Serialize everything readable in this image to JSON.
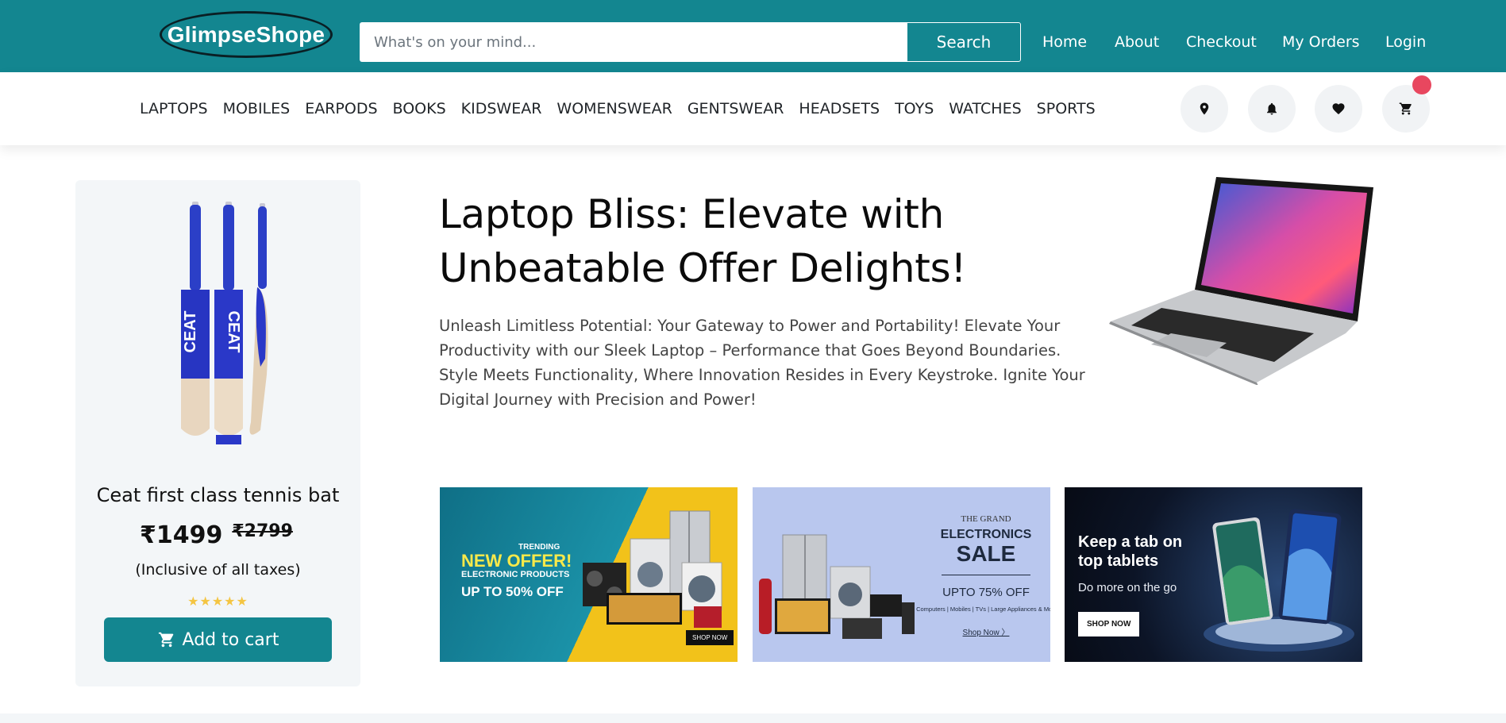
{
  "header": {
    "logo_text": "GlimpseShope",
    "search_placeholder": "What's on your mind...",
    "search_button": "Search",
    "nav": [
      "Home",
      "About",
      "Checkout",
      "My Orders",
      "Login"
    ]
  },
  "categories": [
    "LAPTOPS",
    "MOBILES",
    "EARPODS",
    "BOOKS",
    "KIDSWEAR",
    "WOMENSWEAR",
    "GENTSWEAR",
    "HEADSETS",
    "TOYS",
    "WATCHES",
    "SPORTS"
  ],
  "header_icons": [
    "location-pin-icon",
    "bell-icon",
    "heart-icon",
    "cart-icon"
  ],
  "product": {
    "name": "Ceat first class tennis bat",
    "price": "₹1499",
    "old_price": "₹2799",
    "tax_note": "(Inclusive of all taxes)",
    "rating": "★★★★★",
    "add_to_cart": "Add to cart"
  },
  "hero": {
    "title": "Laptop Bliss: Elevate with Unbeatable Offer Delights!",
    "text": "Unleash Limitless Potential: Your Gateway to Power and Portability! Elevate Your Productivity with our Sleek Laptop – Performance that Goes Beyond Boundaries. Style Meets Functionality, Where Innovation Resides in Every Keystroke. Ignite Your Digital Journey with Precision and Power!"
  },
  "banners": {
    "b1": {
      "trending": "TRENDING",
      "offer": "NEW OFFER!",
      "sub": "ELECTRONIC PRODUCTS",
      "upto": "UP TO 50% OFF",
      "shop": "SHOP NOW"
    },
    "b2": {
      "grand": "THE GRAND",
      "electronics": "ELECTRONICS",
      "sale": "SALE",
      "upto": "UPTO 75% OFF",
      "cats": "Computers | Mobiles | TVs | Large Appliances & More",
      "shop": "Shop Now 〉"
    },
    "b3": {
      "title": "Keep a tab on top tablets",
      "sub": "Do more on the go",
      "shop": "SHOP NOW"
    }
  },
  "colors": {
    "brand": "#138690",
    "badge": "#e8475f",
    "card_bg": "#f3f6f8",
    "star": "#f4c542"
  }
}
